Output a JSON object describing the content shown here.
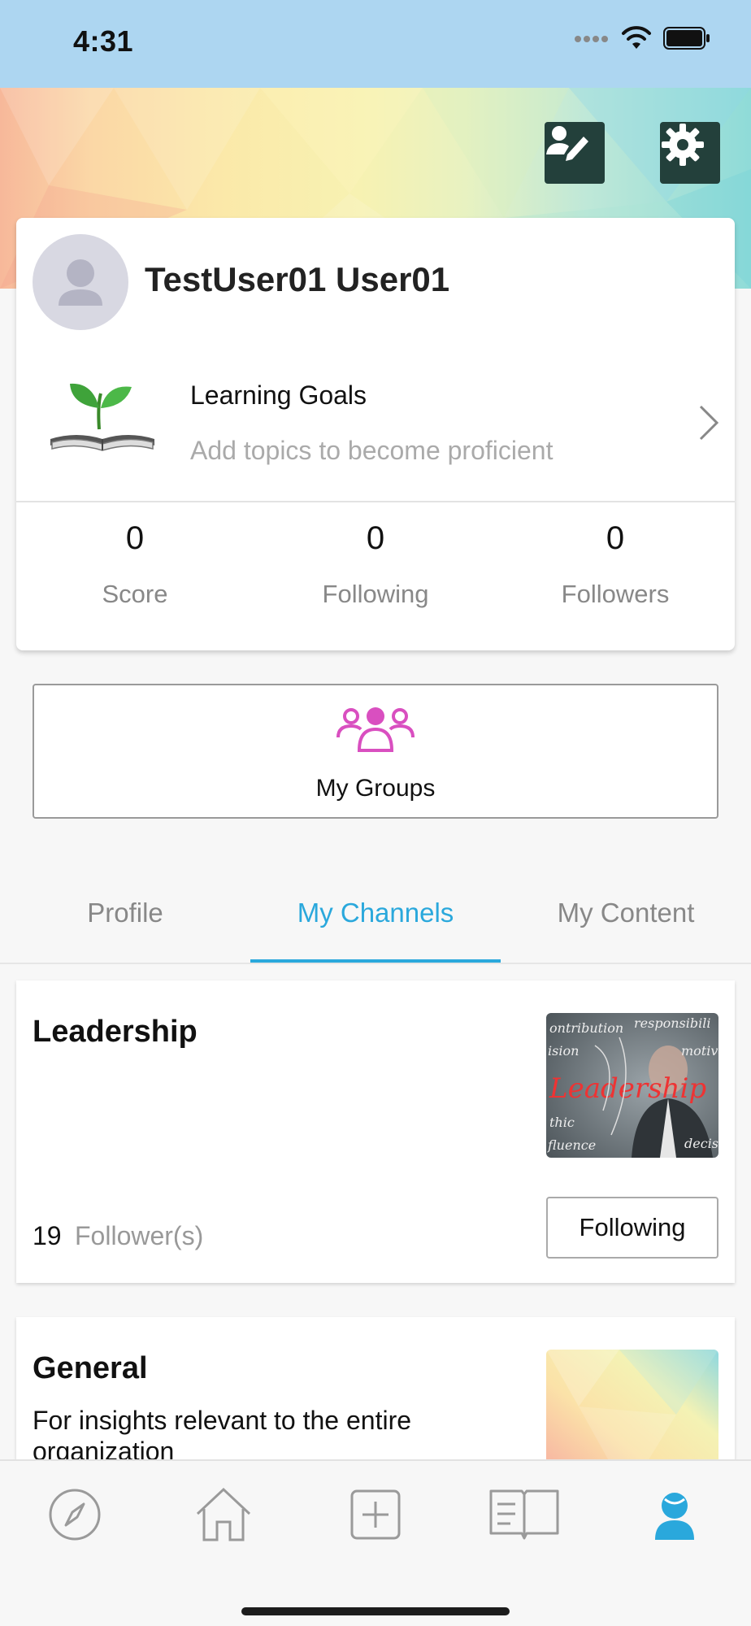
{
  "status_bar": {
    "time": "4:31"
  },
  "profile": {
    "name": "TestUser01 User01",
    "learning_goals": {
      "title": "Learning Goals",
      "subtitle": "Add topics to become proficient"
    },
    "stats": [
      {
        "value": "0",
        "label": "Score"
      },
      {
        "value": "0",
        "label": "Following"
      },
      {
        "value": "0",
        "label": "Followers"
      }
    ]
  },
  "groups": {
    "label": "My Groups"
  },
  "tabs": [
    {
      "label": "Profile",
      "active": false
    },
    {
      "label": "My Channels",
      "active": true
    },
    {
      "label": "My Content",
      "active": false
    }
  ],
  "channels": [
    {
      "title": "Leadership",
      "description": "",
      "followers_count": "19",
      "followers_label": "Follower(s)",
      "button_label": "Following"
    },
    {
      "title": "General",
      "description": "For insights relevant to the entire organization"
    }
  ],
  "bottom_nav": [
    {
      "icon": "compass-icon",
      "active": false
    },
    {
      "icon": "home-icon",
      "active": false
    },
    {
      "icon": "plus-square-icon",
      "active": false
    },
    {
      "icon": "book-icon",
      "active": false
    },
    {
      "icon": "user-icon",
      "active": true
    }
  ],
  "colors": {
    "accent": "#2aa8dc",
    "groups_icon": "#d94fc0",
    "status_bar": "#add6f1",
    "banner_button": "#23403b"
  }
}
